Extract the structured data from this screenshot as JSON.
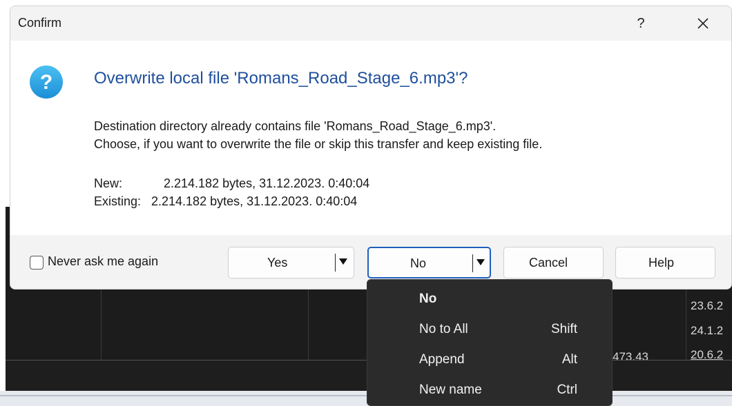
{
  "dialog": {
    "title": "Confirm",
    "help_glyph": "?",
    "heading": "Overwrite local file 'Romans_Road_Stage_6.mp3'?",
    "message_line1": "Destination directory already contains file 'Romans_Road_Stage_6.mp3'.",
    "message_line2": "Choose, if you want to overwrite the file or skip this transfer and keep existing file.",
    "new_label": "New:",
    "new_value": "2.214.182 bytes, 31.12.2023. 0:40:04",
    "existing_label": "Existing:",
    "existing_value": "2.214.182 bytes, 31.12.2023. 0:40:04",
    "icon": "question-icon",
    "accent_color": "#1f4f9c"
  },
  "footer": {
    "never_ask_label": "Never ask me again",
    "never_ask_checked": false,
    "yes_label": "Yes",
    "no_label": "No",
    "cancel_label": "Cancel",
    "help_label": "Help"
  },
  "menu": {
    "items": [
      {
        "label": "No",
        "shortcut": "",
        "bold": true
      },
      {
        "label": "No to All",
        "shortcut": "Shift",
        "bold": false
      },
      {
        "label": "Append",
        "shortcut": "Alt",
        "bold": false
      },
      {
        "label": "New name",
        "shortcut": "Ctrl",
        "bold": false
      }
    ]
  },
  "background": {
    "cells": [
      "23.6.2",
      "24.1.2",
      "20.6.2",
      "473.43"
    ]
  }
}
